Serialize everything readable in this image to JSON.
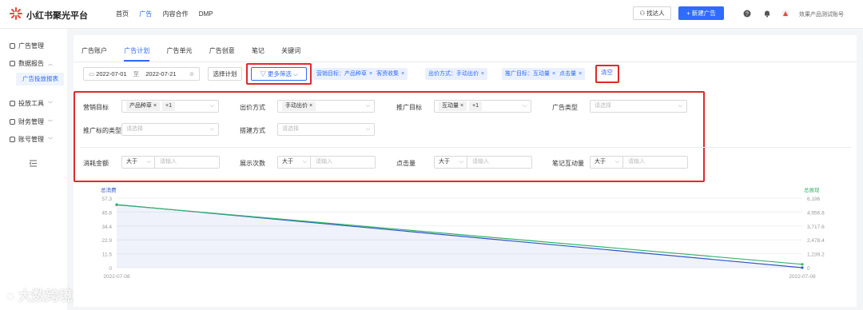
{
  "header": {
    "brand": "小红书聚光平台",
    "nav": [
      "首页",
      "广告",
      "内容合作",
      "DMP"
    ],
    "active_nav": "广告",
    "find_person": "找达人",
    "new_ad": "+ 新建广告",
    "account": "效果产品测试账号",
    "accent": "#2f6bff"
  },
  "sidebar": {
    "items": [
      {
        "label": "广告管理",
        "icon": "ad-icon"
      },
      {
        "label": "数据报告",
        "icon": "report-icon"
      },
      {
        "label": "广告投放报表"
      },
      {
        "label": "投放工具",
        "icon": "tool-icon"
      },
      {
        "label": "财务管理",
        "icon": "finance-icon"
      },
      {
        "label": "账号管理",
        "icon": "account-icon"
      }
    ]
  },
  "tabs": [
    "广告账户",
    "广告计划",
    "广告单元",
    "广告创意",
    "笔记",
    "关键词"
  ],
  "active_tab": "广告计划",
  "toolbar": {
    "date_start": "2022-07-01",
    "date_sep": "至",
    "date_end": "2022-07-21",
    "select_plan": "选择计划",
    "more_filter": "更多筛选",
    "chips": [
      {
        "prefix": "营销目标：",
        "values": [
          "产品种草",
          "客资收集"
        ]
      },
      {
        "prefix": "出价方式：",
        "values": [
          "手动出价"
        ]
      },
      {
        "prefix": "推广目标：",
        "values": [
          "互动量",
          "点击量"
        ]
      }
    ],
    "clear": "清空"
  },
  "filters": {
    "row1": [
      {
        "label": "营销目标",
        "tags": [
          "产品种草"
        ],
        "extra": "+1"
      },
      {
        "label": "出价方式",
        "tags": [
          "手动出价"
        ],
        "extra": ""
      },
      {
        "label": "推广目标",
        "tags": [
          "互动量"
        ],
        "extra": "+1"
      },
      {
        "label": "广告类型",
        "placeholder": "请选择"
      }
    ],
    "row2": [
      {
        "label": "推广标的类型",
        "placeholder": "请选择"
      },
      {
        "label": "搭建方式",
        "placeholder": "请选择"
      }
    ],
    "row3": [
      {
        "label": "消耗金额",
        "op": "大于",
        "placeholder": "请输入"
      },
      {
        "label": "展示次数",
        "op": "大于",
        "placeholder": "请输入"
      },
      {
        "label": "点击量",
        "op": "大于",
        "placeholder": "请输入"
      },
      {
        "label": "笔记互动量",
        "op": "大于",
        "placeholder": "请输入"
      }
    ]
  },
  "chart_data": {
    "type": "line",
    "x": [
      "2022-07-08",
      "2022-07-08"
    ],
    "series": [
      {
        "name": "总消费",
        "axis": "left",
        "color": "#2f54c8",
        "values": [
          52,
          0
        ]
      },
      {
        "name": "总展现",
        "axis": "right",
        "color": "#34b36b",
        "values": [
          5600,
          300
        ]
      }
    ],
    "left_ticks": [
      "57.3",
      "45.8",
      "34.4",
      "22.9",
      "11.5",
      "0"
    ],
    "right_ticks": [
      "6,196",
      "4,956.8",
      "3,717.6",
      "2,478.4",
      "1,239.2",
      "0"
    ],
    "left_label": "总消费",
    "right_label": "总展现",
    "ylim_left": [
      0,
      57.3
    ],
    "ylim_right": [
      0,
      6196
    ],
    "x_ticks": [
      "2022-07-08",
      "2022-07-08"
    ]
  },
  "watermark": "大数跨境"
}
